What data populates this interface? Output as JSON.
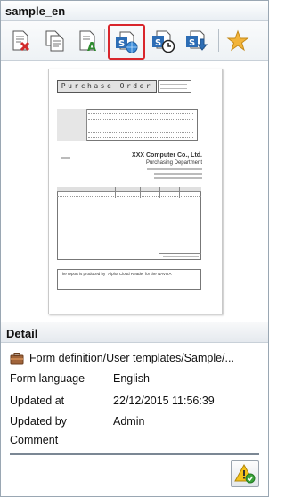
{
  "window": {
    "title": "sample_en"
  },
  "toolbar": {
    "buttons": [
      {
        "name": "delete-form-button",
        "icon": "document-delete-icon"
      },
      {
        "name": "copy-form-button",
        "icon": "documents-copy-icon"
      },
      {
        "name": "edit-text-button",
        "icon": "document-edit-text-icon"
      },
      {
        "name": "preview-button",
        "icon": "preview-globe-icon",
        "selected": true
      },
      {
        "name": "history-button",
        "icon": "clock-history-icon"
      },
      {
        "name": "download-button",
        "icon": "download-icon"
      },
      {
        "name": "favorite-button",
        "icon": "star-icon"
      }
    ]
  },
  "preview": {
    "title": "Purchase Order",
    "company_name": "XXX Computer Co., Ltd.",
    "department": "Purchasing Department",
    "footer_note": "The report is produced by \"Alpha Cloud Reader for the NAVITA\""
  },
  "detail": {
    "header": "Detail",
    "path": "Form definition/User templates/Sample/...",
    "fields": [
      {
        "label": "Form language",
        "value": "English"
      },
      {
        "label": "Updated at",
        "value": "22/12/2015 11:56:39"
      },
      {
        "label": "Updated by",
        "value": "Admin"
      },
      {
        "label": "Comment",
        "value": ""
      }
    ],
    "warning_button_icon": "warning-check-icon"
  },
  "colors": {
    "selected_border": "#d9262c",
    "icon_blue": "#2d6db5",
    "star_gold": "#f2b43b",
    "warning_yellow": "#f4c21a",
    "check_green": "#3aa43a"
  }
}
